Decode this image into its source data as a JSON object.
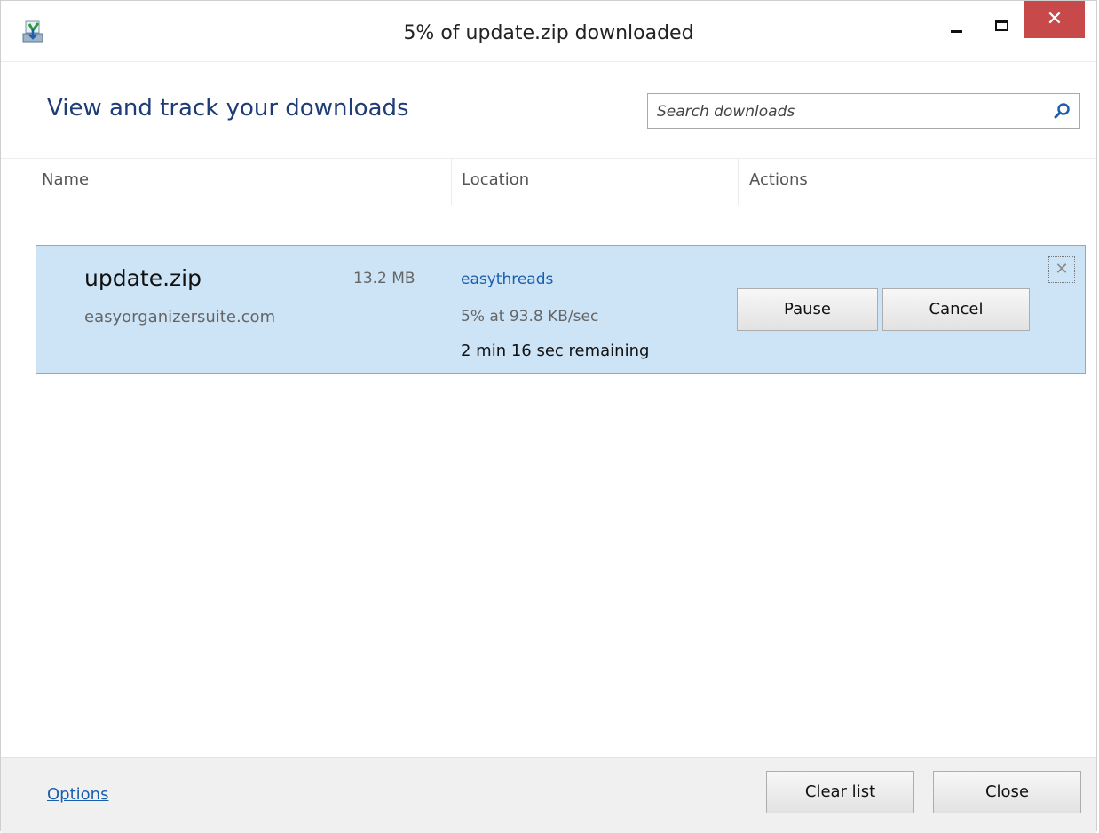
{
  "window": {
    "title": "5% of update.zip downloaded",
    "close_glyph": "✕"
  },
  "header": {
    "heading": "View and track your downloads",
    "search_placeholder": "Search downloads"
  },
  "columns": [
    "Name",
    "Location",
    "Actions"
  ],
  "download": {
    "filename": "update.zip",
    "size": "13.2 MB",
    "source": "easyorganizersuite.com",
    "location": "easythreads",
    "progress": "5% at 93.8 KB/sec",
    "remaining": "2 min 16 sec remaining",
    "pause_label": "Pause",
    "cancel_label": "Cancel",
    "remove_glyph": "✕"
  },
  "footer": {
    "options_label": "Options",
    "clear_pre": "Clear ",
    "clear_ul": "l",
    "clear_post": "ist",
    "close_ul": "C",
    "close_post": "lose"
  },
  "colors": {
    "accent": "#1e3c77",
    "link": "#1a5fad",
    "selected_row": "#cde4f7",
    "close_button": "#c7494a"
  },
  "icons": [
    "download-app-icon",
    "minimize-icon",
    "maximize-icon",
    "close-icon",
    "search-icon",
    "remove-item-icon"
  ]
}
